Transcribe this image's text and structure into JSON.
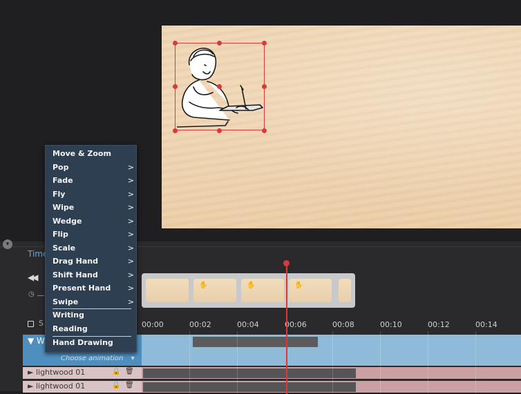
{
  "timeline": {
    "title": "Time",
    "section_label": "S",
    "ticks": [
      "00:00",
      "00:02",
      "00:04",
      "00:06",
      "00:08",
      "00:10",
      "00:12",
      "00:14"
    ],
    "choose_animation": "Choose animation",
    "choose_arrow": "▾",
    "w_row_label": "▼ W",
    "layers": [
      {
        "label": "► lightwood 01"
      },
      {
        "label": "► lightwood 01"
      }
    ]
  },
  "menu": {
    "items": [
      {
        "label": "Move & Zoom",
        "arrow": ""
      },
      {
        "label": "Pop",
        "arrow": ">"
      },
      {
        "label": "Fade",
        "arrow": ">"
      },
      {
        "label": "Fly",
        "arrow": ">"
      },
      {
        "label": "Wipe",
        "arrow": ">"
      },
      {
        "label": "Wedge",
        "arrow": ">"
      },
      {
        "label": "Flip",
        "arrow": ">"
      },
      {
        "label": "Scale",
        "arrow": ">"
      },
      {
        "label": "Drag Hand",
        "arrow": ">"
      },
      {
        "label": "Shift Hand",
        "arrow": ">"
      },
      {
        "label": "Present Hand",
        "arrow": ">"
      },
      {
        "label": "Swipe",
        "arrow": ">"
      },
      {
        "label": "Writing",
        "arrow": ""
      },
      {
        "label": "Reading",
        "arrow": ""
      },
      {
        "label": "Hand Drawing",
        "arrow": ""
      }
    ]
  },
  "icons": {
    "rewind": "◀◀",
    "clock": "◷",
    "collapse": "▾",
    "lock": "🔒",
    "trash": "🗑",
    "hand": "✋"
  },
  "colors": {
    "accent": "#d83a3a",
    "menu_bg": "#2d3f51",
    "timeline_title": "#6aa7d8"
  }
}
